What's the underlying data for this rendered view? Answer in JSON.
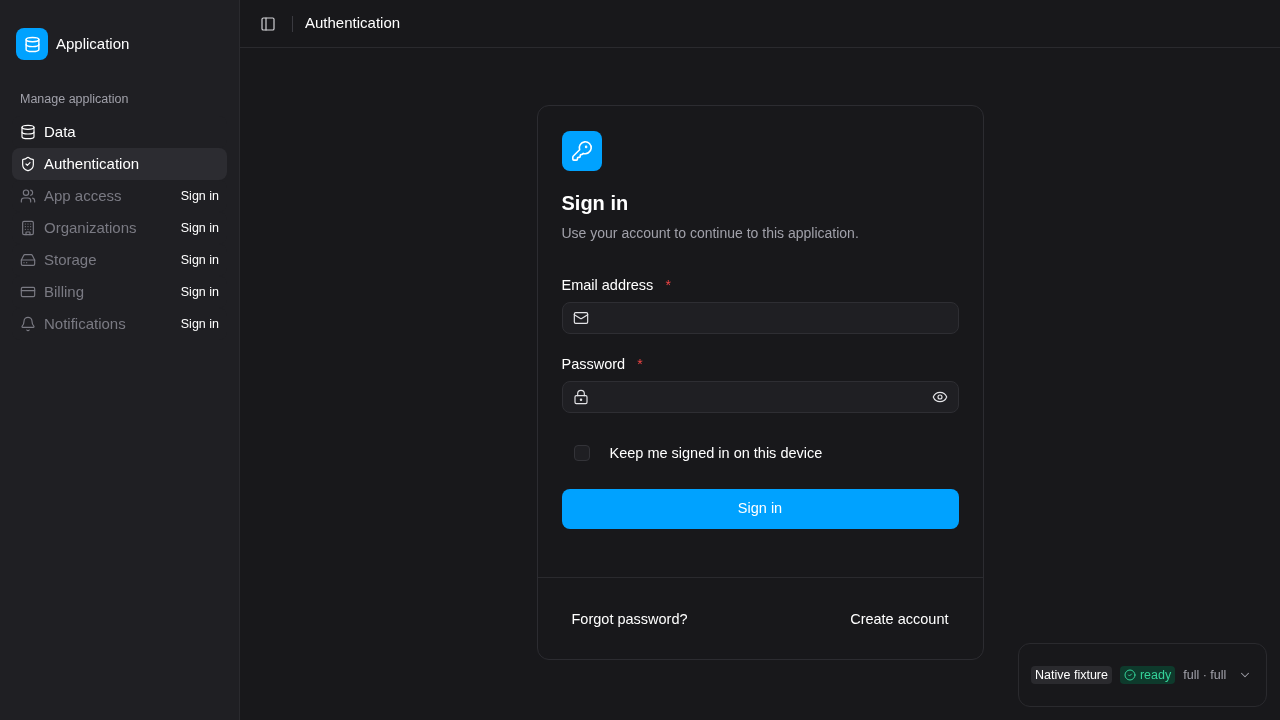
{
  "sidebar": {
    "app_name": "Application",
    "section_label": "Manage application",
    "items": [
      {
        "label": "Data",
        "selected": false,
        "disabled": false
      },
      {
        "label": "Authentication",
        "selected": true,
        "disabled": false
      },
      {
        "label": "App access",
        "selected": false,
        "disabled": true,
        "badge": "Sign in"
      },
      {
        "label": "Organizations",
        "selected": false,
        "disabled": true,
        "badge": "Sign in"
      },
      {
        "label": "Storage",
        "selected": false,
        "disabled": true,
        "badge": "Sign in"
      },
      {
        "label": "Billing",
        "selected": false,
        "disabled": true,
        "badge": "Sign in"
      },
      {
        "label": "Notifications",
        "selected": false,
        "disabled": true,
        "badge": "Sign in"
      }
    ]
  },
  "header": {
    "title": "Authentication"
  },
  "card": {
    "title": "Sign in",
    "subtitle": "Use your account to continue to this application.",
    "fields": [
      {
        "kind": "email",
        "label": "Email address",
        "required_mark": "*"
      },
      {
        "kind": "password",
        "label": "Password",
        "required_mark": "*"
      }
    ],
    "remember": {
      "label": "Keep me signed in on this device",
      "checked": false
    },
    "submit": "Sign in",
    "links": [
      "Forgot password?",
      "Create account"
    ]
  },
  "status_panel": {
    "fixture": "Native fixture",
    "status": {
      "label": "ready",
      "kind": "success"
    },
    "mode": "full · full"
  }
}
